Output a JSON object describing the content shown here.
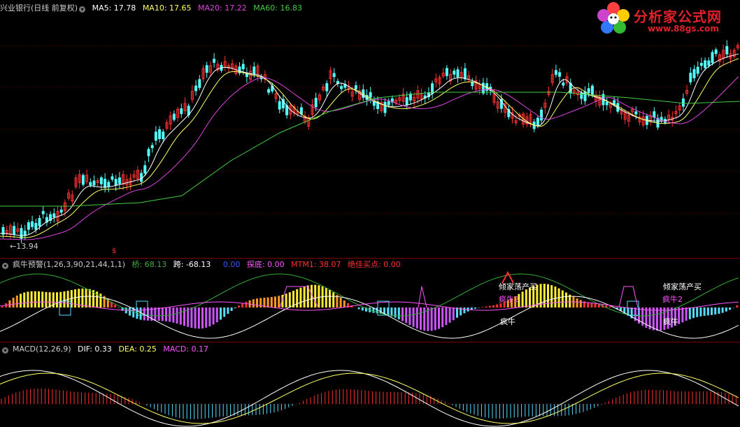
{
  "price_panel": {
    "stock": "兴业银行(日线 前复权)",
    "ma5": "MA5: 17.78",
    "ma10": "MA10: 17.65",
    "ma20": "MA20: 17.22",
    "ma60": "MA60: 16.83",
    "low_marker": "←13.94",
    "event_marker": "$"
  },
  "indicator_panel": {
    "name": "疯牛预警(1,26,3,90,21,44,1,1)",
    "p1": "桥: 68.13",
    "p2": "跨: -68.13",
    "p3": "0.00",
    "p4": "探底: 0.00",
    "p5": "MTM1: 38.07",
    "p6": "绝佳买点: 0.00",
    "labels": [
      "倾家荡产买",
      "疯牛2",
      "疯牛",
      "倾家荡产买",
      "疯牛2",
      "疯牛"
    ]
  },
  "macd_panel": {
    "name": "MACD(12,26,9)",
    "dif": "DIF: 0.33",
    "dea": "DEA: 0.25",
    "macd": "MACD: 0.17"
  },
  "logo": {
    "title": "分析家公式网",
    "url": "www.88gs.com"
  },
  "colors": {
    "ma5": "#ffffff",
    "ma10": "#ffff66",
    "ma20": "#dd44dd",
    "ma60": "#44cc44",
    "up": "#ff3030",
    "down": "#54ffff",
    "grid": "#7a0000"
  }
}
